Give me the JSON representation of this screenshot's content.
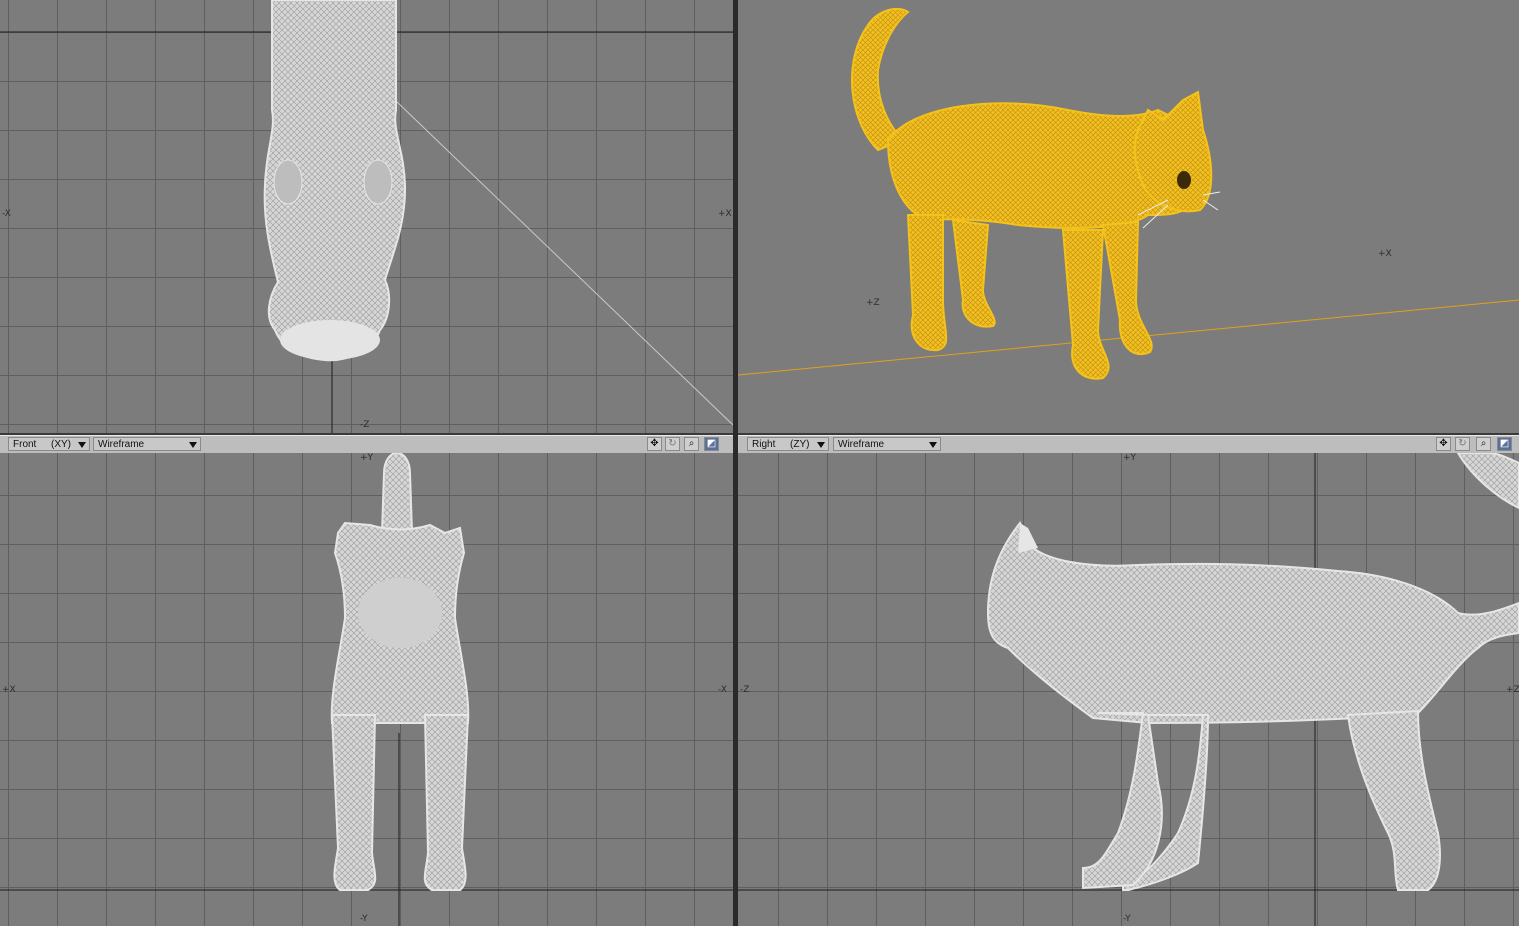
{
  "viewports": {
    "top": {
      "axis_left": "-X",
      "axis_right": "+X",
      "axis_bottom": "-Z"
    },
    "perspective": {
      "axis_x": "+X",
      "axis_z": "+Z"
    },
    "front": {
      "view_name": "Front",
      "projection": "(XY)",
      "shading": "Wireframe",
      "axis_top": "+Y",
      "axis_bottom": "-Y",
      "axis_left": "+X",
      "axis_right": "-X"
    },
    "right": {
      "view_name": "Right",
      "projection": "(ZY)",
      "shading": "Wireframe",
      "axis_top": "+Y",
      "axis_bottom": "-Y",
      "axis_left": "-Z",
      "axis_right": "+Z"
    }
  },
  "toolbar_icons": [
    "move-view-icon",
    "rotate-view-icon",
    "zoom-view-icon",
    "maximize-view-icon"
  ],
  "colors": {
    "viewport_bg": "#7c7c7c",
    "grid_line": "#5f5f5f",
    "wireframe": "#e2e2e2",
    "selected_mesh": "#f5c21a",
    "header_bg": "#bdbdbd"
  }
}
